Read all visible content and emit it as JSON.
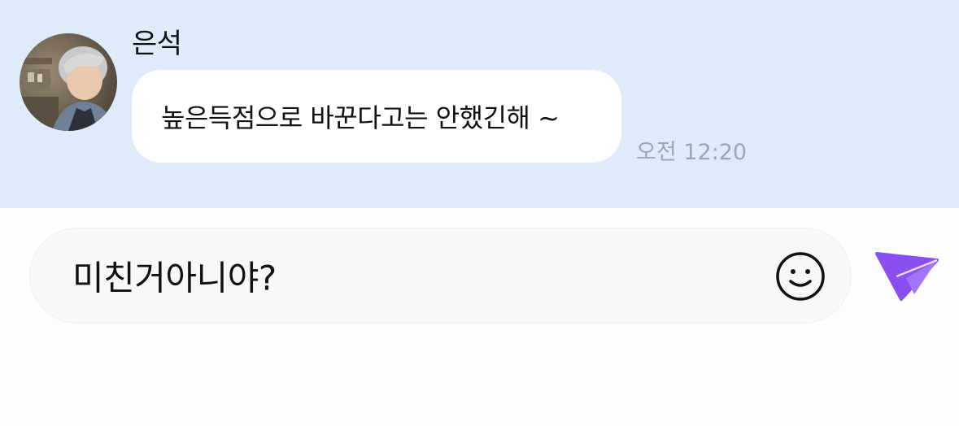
{
  "conversation": {
    "message": {
      "sender_name": "은석",
      "text": "높은득점으로 바꾼다고는 안했긴해 ~",
      "time": "오전 12:20"
    }
  },
  "composer": {
    "input_value": "미친거아니야?",
    "emoji_icon": "smiley-face-icon",
    "send_icon": "paper-plane-icon",
    "send_color": "#8a4ff0"
  },
  "colors": {
    "chat_background": "#ddebfb",
    "bubble": "#ffffff",
    "timestamp": "#9ea6b0"
  }
}
